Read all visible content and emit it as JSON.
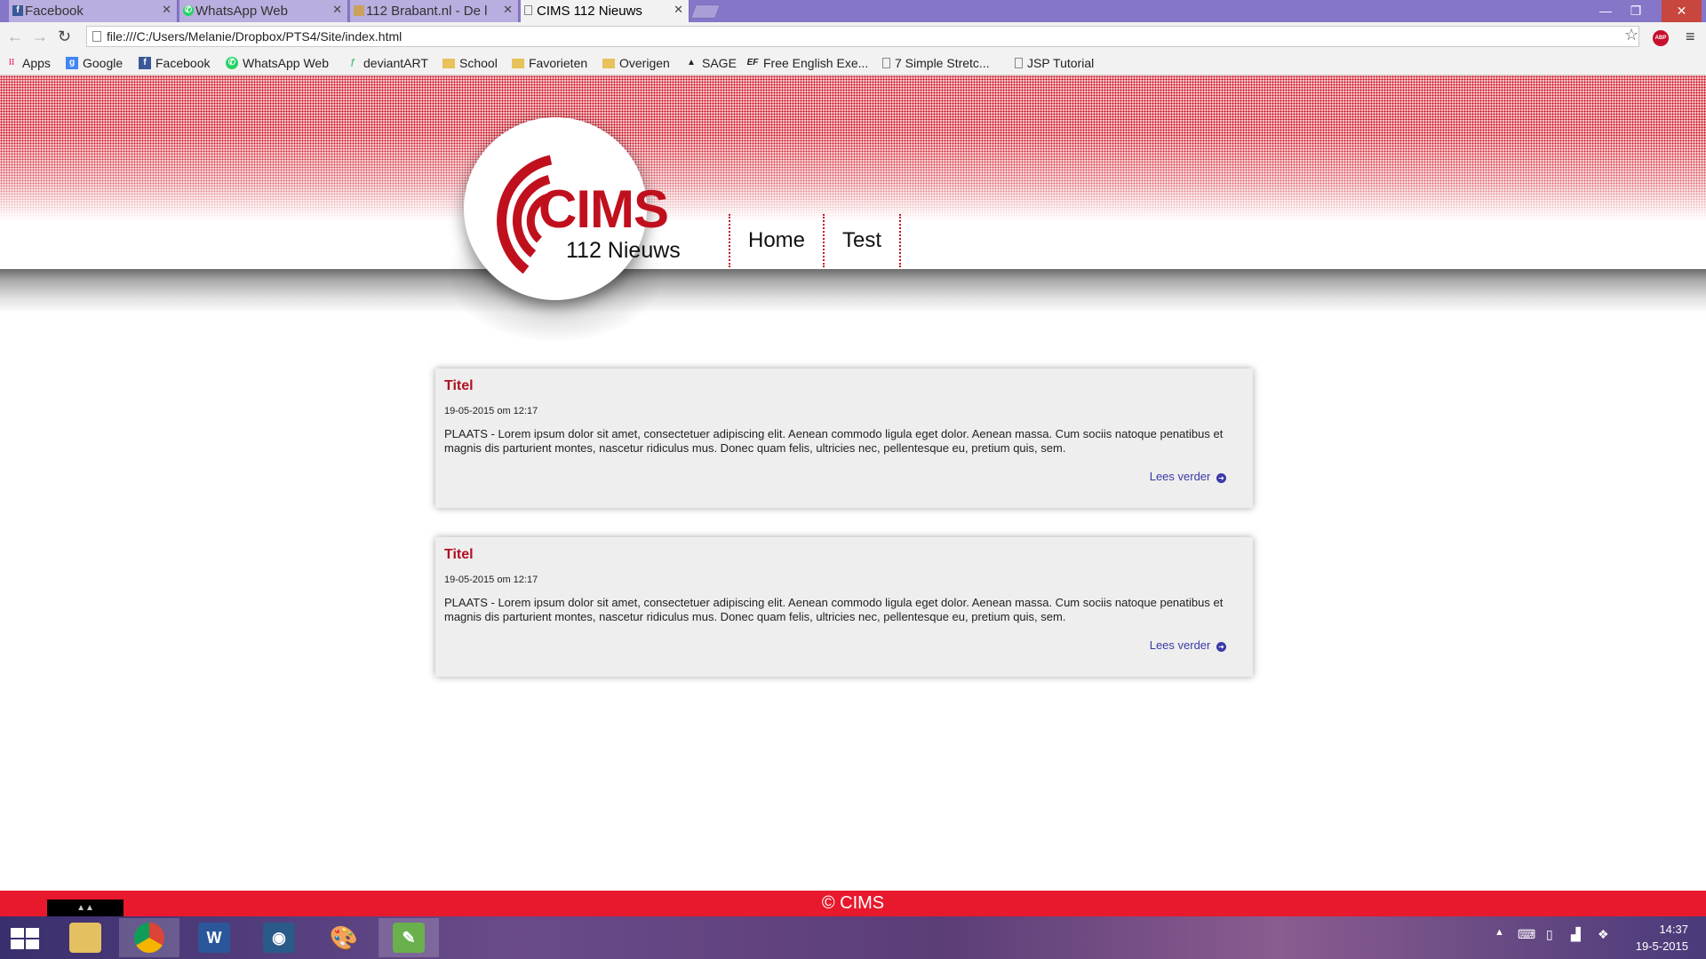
{
  "browser": {
    "tabs": [
      {
        "label": "Facebook",
        "icon": "facebook-icon"
      },
      {
        "label": "WhatsApp Web",
        "icon": "whatsapp-icon"
      },
      {
        "label": "112 Brabant.nl - De l",
        "icon": "page-icon"
      },
      {
        "label": "CIMS 112 Nieuws",
        "icon": "page-icon"
      }
    ],
    "url": "file:///C:/Users/Melanie/Dropbox/PTS4/Site/index.html",
    "bookmarks": [
      {
        "label": "Apps",
        "icon": "apps-icon"
      },
      {
        "label": "Google",
        "icon": "google-icon"
      },
      {
        "label": "Facebook",
        "icon": "facebook-icon"
      },
      {
        "label": "WhatsApp Web",
        "icon": "whatsapp-icon"
      },
      {
        "label": "deviantART",
        "icon": "deviantart-icon"
      },
      {
        "label": "School",
        "icon": "folder-icon"
      },
      {
        "label": "Favorieten",
        "icon": "folder-icon"
      },
      {
        "label": "Overigen",
        "icon": "folder-icon"
      },
      {
        "label": "SAGE",
        "icon": "sage-icon"
      },
      {
        "label": "Free English Exe...",
        "icon": "ef-icon"
      },
      {
        "label": "7 Simple Stretc...",
        "icon": "page-icon"
      },
      {
        "label": "JSP Tutorial",
        "icon": "page-icon"
      }
    ],
    "abp_label": "ABP"
  },
  "site": {
    "logo_title": "CIMS",
    "logo_sub": "112 Nieuws",
    "nav": [
      "Home",
      "Test"
    ],
    "articles": [
      {
        "title": "Titel",
        "date": "19-05-2015 om 12:17",
        "body": "PLAATS - Lorem ipsum dolor sit amet, consectetuer adipiscing elit. Aenean commodo ligula eget dolor. Aenean massa. Cum sociis natoque penatibus et magnis dis parturient montes, nascetur ridiculus mus. Donec quam felis, ultricies nec, pellentesque eu, pretium quis, sem.",
        "more": "Lees verder"
      },
      {
        "title": "Titel",
        "date": "19-05-2015 om 12:17",
        "body": "PLAATS - Lorem ipsum dolor sit amet, consectetuer adipiscing elit. Aenean commodo ligula eget dolor. Aenean massa. Cum sociis natoque penatibus et magnis dis parturient montes, nascetur ridiculus mus. Donec quam felis, ultricies nec, pellentesque eu, pretium quis, sem.",
        "more": "Lees verder"
      }
    ],
    "footer": "© CIMS",
    "colors": {
      "brand_red": "#c0101e",
      "footer_red": "#e8192c",
      "link": "#3a3aa8"
    }
  },
  "taskbar": {
    "time": "14:37",
    "date": "19-5-2015"
  }
}
